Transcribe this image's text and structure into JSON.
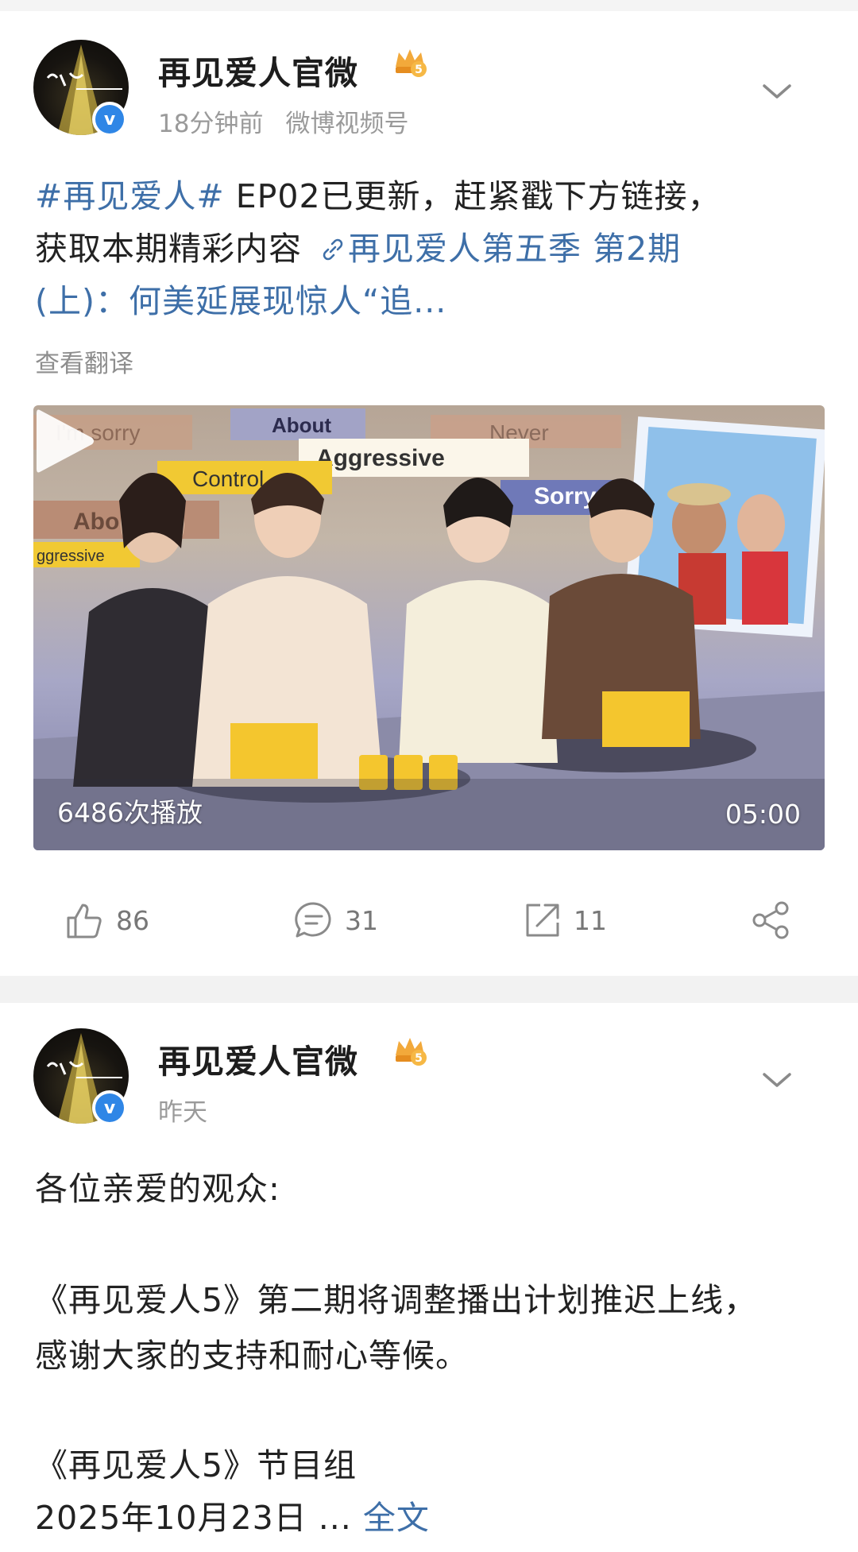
{
  "posts": [
    {
      "author": "再见爱人官微",
      "time": "18分钟前",
      "source": "微博视频号",
      "text": {
        "hashtag": "#再见爱人#",
        "line1_rest": " EP02已更新，赶紧戳下方链接，",
        "line2_start": "获取本期精彩内容",
        "link_part1": "再见爱人第五季 第2期",
        "link_part2": "(上)：何美延展现惊人“追..."
      },
      "translate_label": "查看翻译",
      "video": {
        "plays": "6486次播放",
        "duration": "05:00",
        "overlay_words": [
          "I'm sorry",
          "About",
          "Never",
          "Aggressive",
          "Control",
          "Sorry",
          "Abo",
          "ggressive"
        ]
      },
      "actions": {
        "likes": "86",
        "comments": "31",
        "reposts": "11"
      }
    },
    {
      "author": "再见爱人官微",
      "time": "昨天",
      "lines": [
        "各位亲爱的观众:",
        "《再见爱人5》第二期将调整播出计划推迟上线，",
        "感谢大家的支持和耐心等候。",
        "《再见爱人5》节目组",
        "2025年10月23日 ..."
      ],
      "full_text_label": "全文"
    }
  ],
  "colors": {
    "link": "#3e6fa8",
    "verified": "#2f86e6",
    "muted": "#9a9a9a",
    "crown": "#f2a93b"
  },
  "icons": [
    "verified-icon",
    "crown-icon",
    "chevron-down-icon",
    "link-icon",
    "play-icon",
    "like-icon",
    "comment-icon",
    "repost-icon",
    "share-icon"
  ]
}
